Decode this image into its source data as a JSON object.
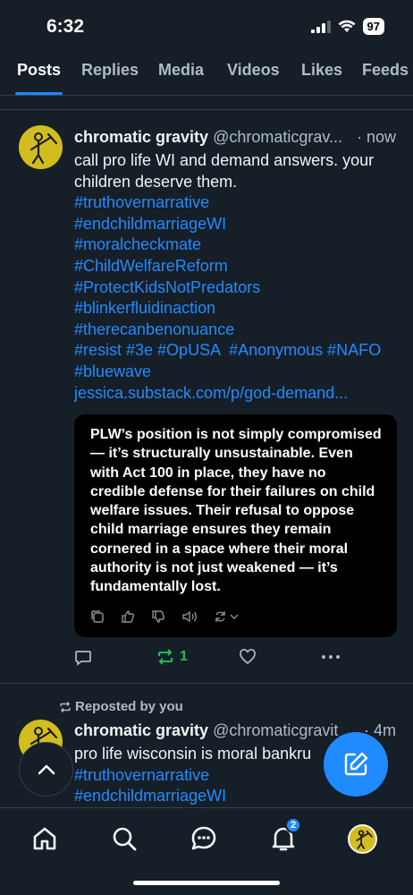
{
  "status_bar": {
    "time": "6:32",
    "battery": "97"
  },
  "tabs": [
    "Posts",
    "Replies",
    "Media",
    "Videos",
    "Likes",
    "Feeds"
  ],
  "post1": {
    "name": "chromatic gravity",
    "handle": "@chromaticgrav...",
    "time": "· now",
    "text": "call pro life WI and demand answers. your children deserve them.",
    "hashtags": [
      "#truthovernarrative",
      "#endchildmarriageWI",
      "#moralcheckmate",
      "#ChildWelfareReform",
      "#ProtectKidsNotPredators",
      "#blinkerfluidinaction",
      "#therecanbenonuance"
    ],
    "hashtag_line": "#resist #3e #OpUSA  #Anonymous #NAFO",
    "hashtag_last": "#bluewave",
    "link": "jessica.substack.com/p/god-demand...",
    "quote": "PLW’s position is not simply compromised — it’s structurally unsustainable. Even with Act 100 in place, they have no credible defense for their failures on child welfare issues. Their refusal to oppose child marriage ensures they remain cornered in a space where their moral authority is not just weakened — it’s fundamentally lost.",
    "repost_count": "1"
  },
  "post2": {
    "repost_note": "Reposted by you",
    "name": "chromatic gravity",
    "handle": "@chromaticgravit",
    "time": "· 4m",
    "text": "pro life wisconsin is moral bankru",
    "hashtags": [
      "#truthovernarrative",
      "#endchildmarriageWI"
    ]
  },
  "nav": {
    "notification_badge": "2"
  },
  "colors": {
    "accent": "#208bfe",
    "repost_green": "#20bc53",
    "background": "#161e27"
  }
}
